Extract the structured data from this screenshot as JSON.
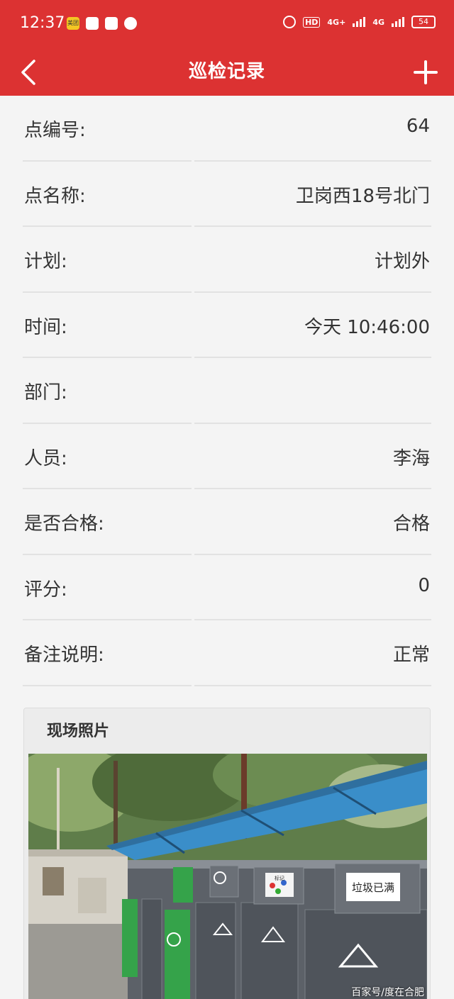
{
  "status_bar": {
    "time": "12:37",
    "app_icons": [
      "meitu-app-icon",
      "compass-app-icon",
      "telegram-app-icon",
      "chat-app-icon"
    ],
    "meitu_label": "美团",
    "hd_label": "HD",
    "network_1": "4G+",
    "network_2": "4G",
    "battery": "54"
  },
  "nav": {
    "title": "巡检记录",
    "back_icon": "chevron-left-icon",
    "add_icon": "plus-icon"
  },
  "fields": [
    {
      "label": "点编号:",
      "value": "64"
    },
    {
      "label": "点名称:",
      "value": "卫岗西18号北门"
    },
    {
      "label": "计划:",
      "value": "计划外"
    },
    {
      "label": "时间:",
      "value": "今天 10:46:00"
    },
    {
      "label": "部门:",
      "value": ""
    },
    {
      "label": "人员:",
      "value": "李海"
    },
    {
      "label": "是否合格:",
      "value": "合格"
    },
    {
      "label": "评分:",
      "value": "0"
    },
    {
      "label": "备注说明:",
      "value": "正常"
    }
  ],
  "photo_section": {
    "title": "现场照片",
    "sign_full": "垃圾已满",
    "sign_small": "标记"
  },
  "watermark": "百家号/度在合肥",
  "colors": {
    "header_bg": "#dc3232",
    "page_bg": "#f4f4f4",
    "text": "#333333"
  }
}
